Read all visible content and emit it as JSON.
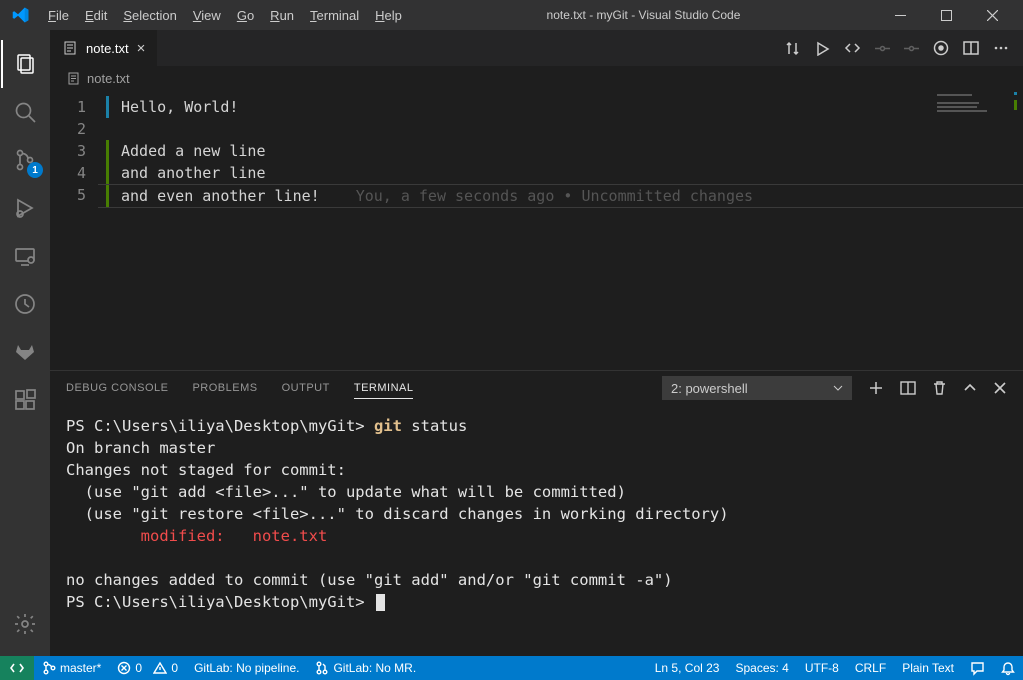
{
  "menu": [
    "File",
    "Edit",
    "Selection",
    "View",
    "Go",
    "Run",
    "Terminal",
    "Help"
  ],
  "menu_names": [
    "file",
    "edit",
    "selection",
    "view",
    "go",
    "run",
    "terminal",
    "help"
  ],
  "title": "note.txt - myGit - Visual Studio Code",
  "scm_badge": "1",
  "tab": {
    "name": "note.txt",
    "breadcrumb": "note.txt"
  },
  "editor": {
    "lines": [
      "Hello, World!",
      "",
      "Added a new line",
      "and another line",
      "and even another line!"
    ],
    "gitlens": "You, a few seconds ago • Uncommitted changes"
  },
  "panel": {
    "tabs": [
      "DEBUG CONSOLE",
      "PROBLEMS",
      "OUTPUT",
      "TERMINAL"
    ],
    "tab_names": [
      "debug-console",
      "problems",
      "output",
      "terminal"
    ],
    "select": "2: powershell"
  },
  "terminal": {
    "prompt1": "PS C:\\Users\\iliya\\Desktop\\myGit> ",
    "cmd": "git",
    "cmd2": " status",
    "out": "On branch master\nChanges not staged for commit:\n  (use \"git add <file>...\" to update what will be committed)\n  (use \"git restore <file>...\" to discard changes in working directory)",
    "mod": "        modified:   note.txt",
    "out2": "no changes added to commit (use \"git add\" and/or \"git commit -a\")",
    "prompt2": "PS C:\\Users\\iliya\\Desktop\\myGit> "
  },
  "status": {
    "branch": "master*",
    "errors": "0",
    "warnings": "0",
    "gitlab1": "GitLab: No pipeline.",
    "gitlab2": "GitLab: No MR.",
    "pos": "Ln 5, Col 23",
    "spaces": "Spaces: 4",
    "enc": "UTF-8",
    "eol": "CRLF",
    "lang": "Plain Text"
  }
}
